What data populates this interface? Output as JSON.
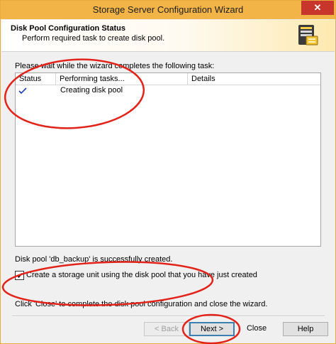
{
  "window": {
    "title": "Storage Server Configuration Wizard",
    "close_glyph": "✕"
  },
  "header": {
    "title": "Disk Pool Configuration Status",
    "subtitle": "Perform required task to create disk pool."
  },
  "instruction": "Please wait while the wizard completes the following task:",
  "task_table": {
    "columns": [
      "Status",
      "Performing tasks...",
      "Details"
    ],
    "rows": [
      {
        "status_icon": "checkmark-icon",
        "task": "Creating disk pool",
        "details": ""
      }
    ]
  },
  "status_message": "Disk pool 'db_backup' is successfully created.",
  "create_storage_unit": {
    "label": "Create a storage unit using the disk pool that you have just created",
    "checked": true
  },
  "close_hint": "Click 'Close' to complete the disk pool configuration and close the wizard.",
  "buttons": {
    "back": "< Back",
    "next": "Next >",
    "close": "Close",
    "help": "Help"
  },
  "colors": {
    "accent": "#f3b447",
    "annotation": "#e2231a",
    "check": "#1f3fb0"
  }
}
